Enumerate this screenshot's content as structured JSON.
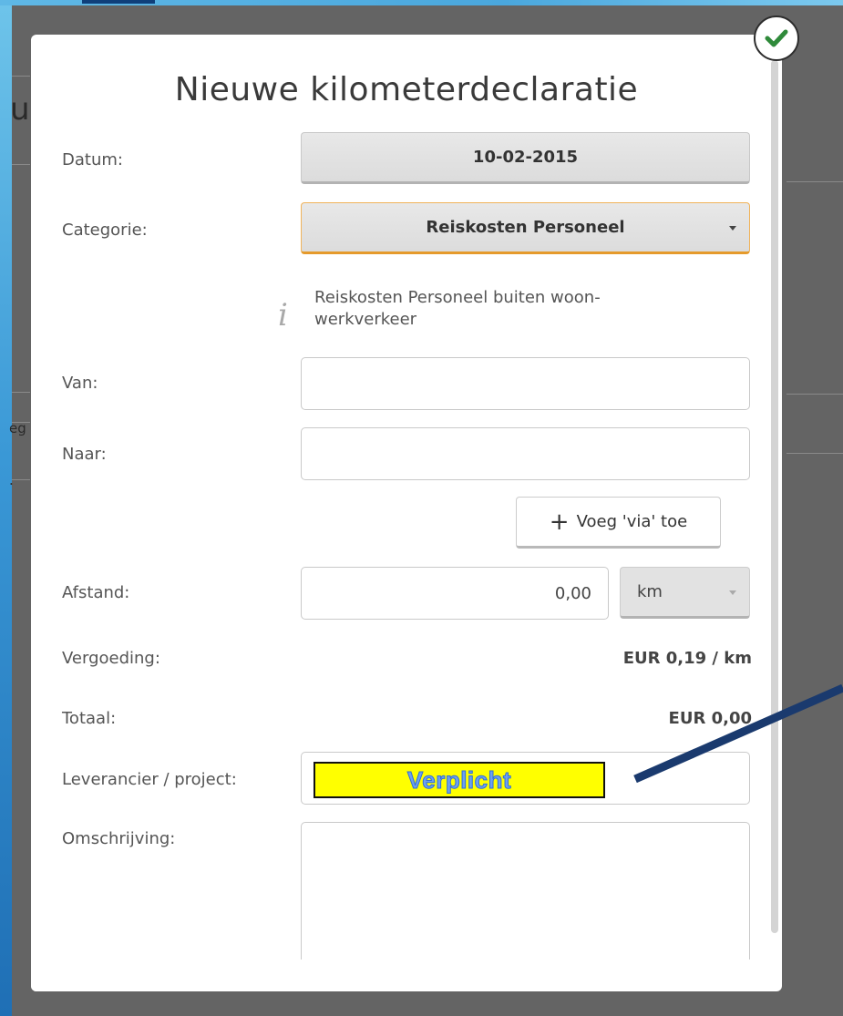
{
  "background": {
    "fragment_title": "ul",
    "fragment_row1": "eg",
    "fragment_row2": "."
  },
  "modal": {
    "title": "Nieuwe kilometerdeclaratie",
    "confirm_icon": "checkmark-icon",
    "fields": {
      "datum": {
        "label": "Datum:",
        "value": "10-02-2015"
      },
      "categorie": {
        "label": "Categorie:",
        "value": "Reiskosten Personeel",
        "info_icon": "info-icon",
        "info_text": "Reiskosten Personeel buiten woon-werkverkeer"
      },
      "van": {
        "label": "Van:",
        "value": ""
      },
      "naar": {
        "label": "Naar:",
        "value": ""
      },
      "via_button": {
        "icon": "plus-icon",
        "label": "Voeg 'via' toe"
      },
      "afstand": {
        "label": "Afstand:",
        "value": "0,00",
        "unit": "km"
      },
      "vergoeding": {
        "label": "Vergoeding:",
        "value": "EUR 0,19 / km"
      },
      "totaal": {
        "label": "Totaal:",
        "value": "EUR 0,00"
      },
      "leverancier": {
        "label": "Leverancier / project:",
        "value": ""
      },
      "omschrijving": {
        "label": "Omschrijving:",
        "value": ""
      }
    }
  },
  "annotation": {
    "callout_text": "Verplicht",
    "callout_bg": "#ffff00",
    "callout_text_color": "#6fa0ef",
    "arrow_color": "#1a3a6e"
  },
  "colors": {
    "frame_blue": "#3a98d6",
    "overlay": "#646464",
    "primary_border": "#e59a2b"
  }
}
